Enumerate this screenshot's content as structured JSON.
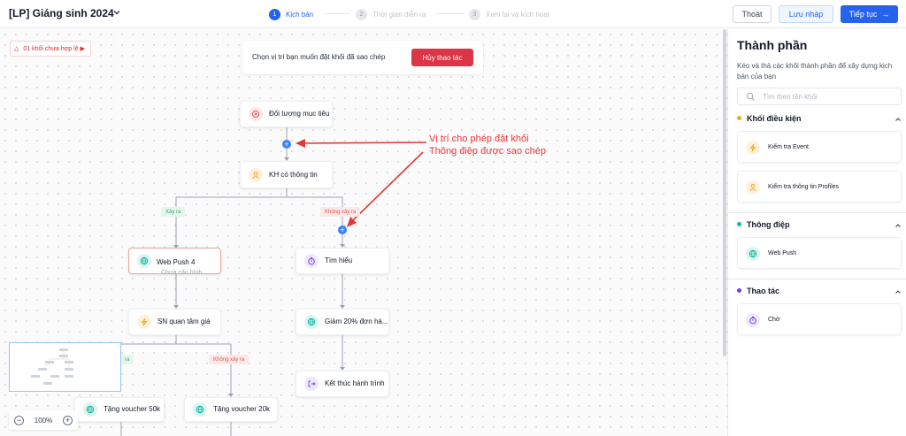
{
  "header": {
    "project_title": "[LP] Giáng sinh 2024",
    "steps": [
      {
        "number": "1",
        "label": "Kịch bản",
        "state": "active"
      },
      {
        "number": "2",
        "label": "Thời gian diễn ra",
        "state": "inactive"
      },
      {
        "number": "3",
        "label": "Xem lại và kích hoạt",
        "state": "inactive"
      }
    ],
    "exit_label": "Thoát",
    "draft_label": "Lưu nháp",
    "next_label": "Tiếp tục",
    "next_arrow": "→"
  },
  "canvas": {
    "invalid_blocks_label": "01 khối chưa hợp lệ",
    "banner": {
      "message": "Chọn vị trí bạn muốn đặt khối đã sao chép",
      "cancel_label": "Hủy thao tác"
    },
    "annotation": {
      "line1": "Vị trí cho phép đặt khối",
      "line2": "Thông điệp được sao chép"
    },
    "nodes": {
      "target": "Đối tượng mục tiêu",
      "has_info": "KH có thông tin",
      "web_push": "Web Push 4",
      "web_push_sub": "Chưa cấu hình",
      "learn": "Tìm hiểu",
      "birthday": "SN quan tâm giá",
      "discount": "Giảm 20% đơn hà...",
      "end": "Kết thúc hành trình",
      "voucher50": "Tặng voucher 50k",
      "voucher20": "Tặng voucher 20k"
    },
    "branches": {
      "yes": "Xảy ra",
      "no": "Không xảy ra",
      "yes_partial": "ra",
      "no2": "Không xảy ra"
    },
    "zoom": "100%"
  },
  "sidebar": {
    "title": "Thành phần",
    "description": "Kéo và thả các khối thành phần để xây dựng kịch bản của bạn",
    "search_placeholder": "Tìm theo tên khối",
    "sections": [
      {
        "title": "Khối điều kiện",
        "color": "#f5a524",
        "items": [
          "Kiểm tra Event",
          "Kiểm tra thông tin Profiles"
        ]
      },
      {
        "title": "Thông điệp",
        "color": "#14b8a6",
        "items": [
          "Web Push"
        ]
      },
      {
        "title": "Thao tác",
        "color": "#7c3aed",
        "items": [
          "Chờ"
        ]
      }
    ]
  },
  "colors": {
    "primary": "#2563eb",
    "danger": "#dc3545",
    "annotation": "#e53935"
  }
}
